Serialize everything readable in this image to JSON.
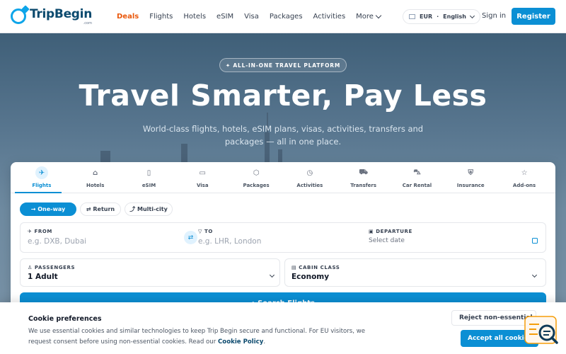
{
  "header": {
    "logo_text": "TripBegin",
    "logo_sub": ".com",
    "nav": [
      "Deals",
      "Flights",
      "Hotels",
      "eSIM",
      "Visa",
      "Packages",
      "Activities"
    ],
    "more_label": "More",
    "currency": "EUR",
    "separator": "·",
    "language": "English",
    "signin_label": "Sign in",
    "register_label": "Register"
  },
  "hero": {
    "badge": "✦ ALL-IN-ONE TRAVEL PLATFORM",
    "title": "Travel Smarter, Pay Less",
    "subtitle": "World-class flights, hotels, eSIM plans, visas, activities, transfers and packages — all in one place."
  },
  "tabs": [
    {
      "label": "Flights",
      "icon": "plane-icon",
      "glyph": "✈"
    },
    {
      "label": "Hotels",
      "icon": "building-icon",
      "glyph": "⌂"
    },
    {
      "label": "eSIM",
      "icon": "sim-card-icon",
      "glyph": "▯"
    },
    {
      "label": "Visa",
      "icon": "passport-icon",
      "glyph": "▭"
    },
    {
      "label": "Packages",
      "icon": "package-icon",
      "glyph": "⬡"
    },
    {
      "label": "Activities",
      "icon": "clock-icon",
      "glyph": "◷"
    },
    {
      "label": "Transfers",
      "icon": "shuttle-icon",
      "glyph": "⛟"
    },
    {
      "label": "Car Rental",
      "icon": "car-icon",
      "glyph": "⛍"
    },
    {
      "label": "Insurance",
      "icon": "shield-icon",
      "glyph": "⛨"
    },
    {
      "label": "Add-ons",
      "icon": "star-icon",
      "glyph": "☆"
    }
  ],
  "trip_types": {
    "one_way": "→ One-way",
    "return": "⇄ Return",
    "multi_city": "⤴ Multi-city"
  },
  "form": {
    "from_label": "✈ FROM",
    "from_placeholder": "e.g. DXB, Dubai",
    "to_label": "▽ TO",
    "to_placeholder": "e.g. LHR, London",
    "departure_label": "▣ DEPARTURE",
    "departure_placeholder": "Select date",
    "passengers_label": "♙ PASSENGERS",
    "passengers_value": "1 Adult",
    "cabin_label": "▤ CABIN CLASS",
    "cabin_value": "Economy",
    "search_label": "⌕ Search Flights"
  },
  "cookie": {
    "title": "Cookie preferences",
    "text": "We use essential cookies and similar technologies to keep Trip Begin secure and functional. For EU visitors, we request consent before using non-essential cookies. Read our",
    "link": "Cookie Policy",
    "period": ".",
    "reject_label": "Reject non-essential",
    "accept_label": "Accept all cookies"
  },
  "colors": {
    "brand": "#0b8fd4",
    "deals": "#ea580c"
  }
}
